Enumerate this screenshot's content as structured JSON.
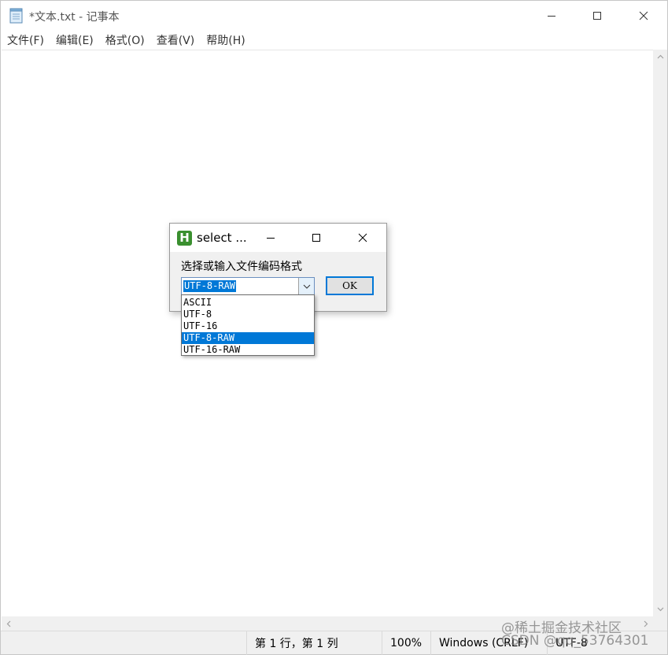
{
  "window": {
    "title": "*文本.txt - 记事本"
  },
  "menu": [
    {
      "label": "文件(F)"
    },
    {
      "label": "编辑(E)"
    },
    {
      "label": "格式(O)"
    },
    {
      "label": "查看(V)"
    },
    {
      "label": "帮助(H)"
    }
  ],
  "editor": {
    "content": ""
  },
  "status": {
    "position": "第 1 行，第 1 列",
    "zoom": "100%",
    "line_ending": "Windows (CRLF)",
    "encoding": "UTF-8"
  },
  "watermark": {
    "line1": "@稀土掘金技术社区",
    "line2": "CSDN @qq_53764301"
  },
  "dialog": {
    "icon_letter": "H",
    "title": "select ...",
    "prompt": "选择或输入文件编码格式",
    "combo_value": "UTF-8-RAW",
    "ok_label": "OK",
    "options": [
      {
        "label": "ASCII",
        "selected": false
      },
      {
        "label": "UTF-8",
        "selected": false
      },
      {
        "label": "UTF-16",
        "selected": false
      },
      {
        "label": "UTF-8-RAW",
        "selected": true
      },
      {
        "label": "UTF-16-RAW",
        "selected": false
      }
    ]
  },
  "colors": {
    "accent": "#0078d7",
    "dialog_icon": "#3a8f2f"
  },
  "icons": {
    "app": "notepad-icon",
    "minimize": "minimize-icon",
    "maximize": "maximize-icon",
    "close": "close-icon",
    "dropdown": "chevron-down-icon"
  }
}
